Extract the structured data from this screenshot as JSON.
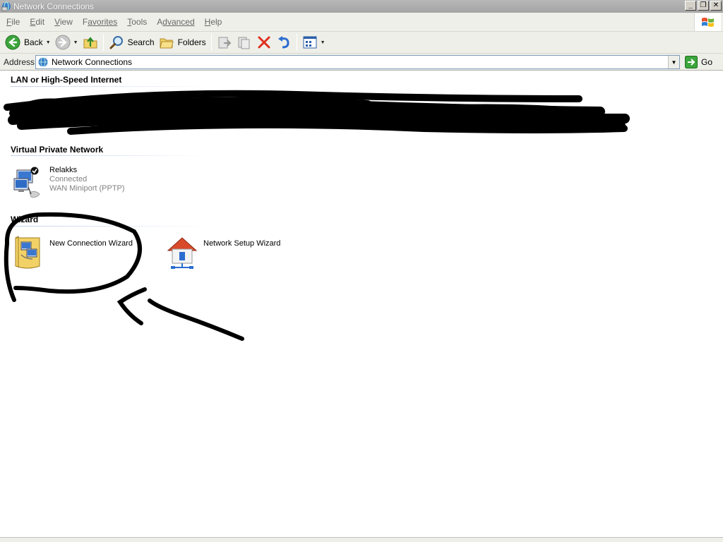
{
  "window": {
    "title": "Network Connections",
    "buttons": {
      "minimize": "_",
      "restore": "❐",
      "close": "✕"
    }
  },
  "menu": {
    "items": [
      {
        "mnemonic": "F",
        "rest": "ile"
      },
      {
        "mnemonic": "E",
        "rest": "dit"
      },
      {
        "mnemonic": "V",
        "rest": "iew"
      },
      {
        "mnemonic": "",
        "rest": "Favorites",
        "pre": "F",
        "post": "avorites"
      },
      {
        "mnemonic": "T",
        "rest": "ools"
      },
      {
        "mnemonic": "",
        "pre": "A",
        "post": "dvanced"
      },
      {
        "mnemonic": "H",
        "rest": "elp"
      }
    ]
  },
  "toolbar": {
    "back_label": "Back",
    "search_label": "Search",
    "folders_label": "Folders"
  },
  "address": {
    "label": "Address",
    "value": "Network Connections",
    "go_label": "Go"
  },
  "groups": {
    "lan": {
      "title": "LAN or High-Speed Internet"
    },
    "vpn": {
      "title": "Virtual Private Network"
    },
    "wizard": {
      "title": "Wizard"
    }
  },
  "vpn_item": {
    "name": "Relakks",
    "status": "Connected",
    "device": "WAN Miniport (PPTP)"
  },
  "wizards": {
    "new_connection": "New Connection Wizard",
    "network_setup": "Network Setup Wizard"
  },
  "colors": {
    "title_bar": "#a9a9a9",
    "chrome": "#efefe9",
    "header_line": "#c0d0e8",
    "ink": "#000000"
  }
}
